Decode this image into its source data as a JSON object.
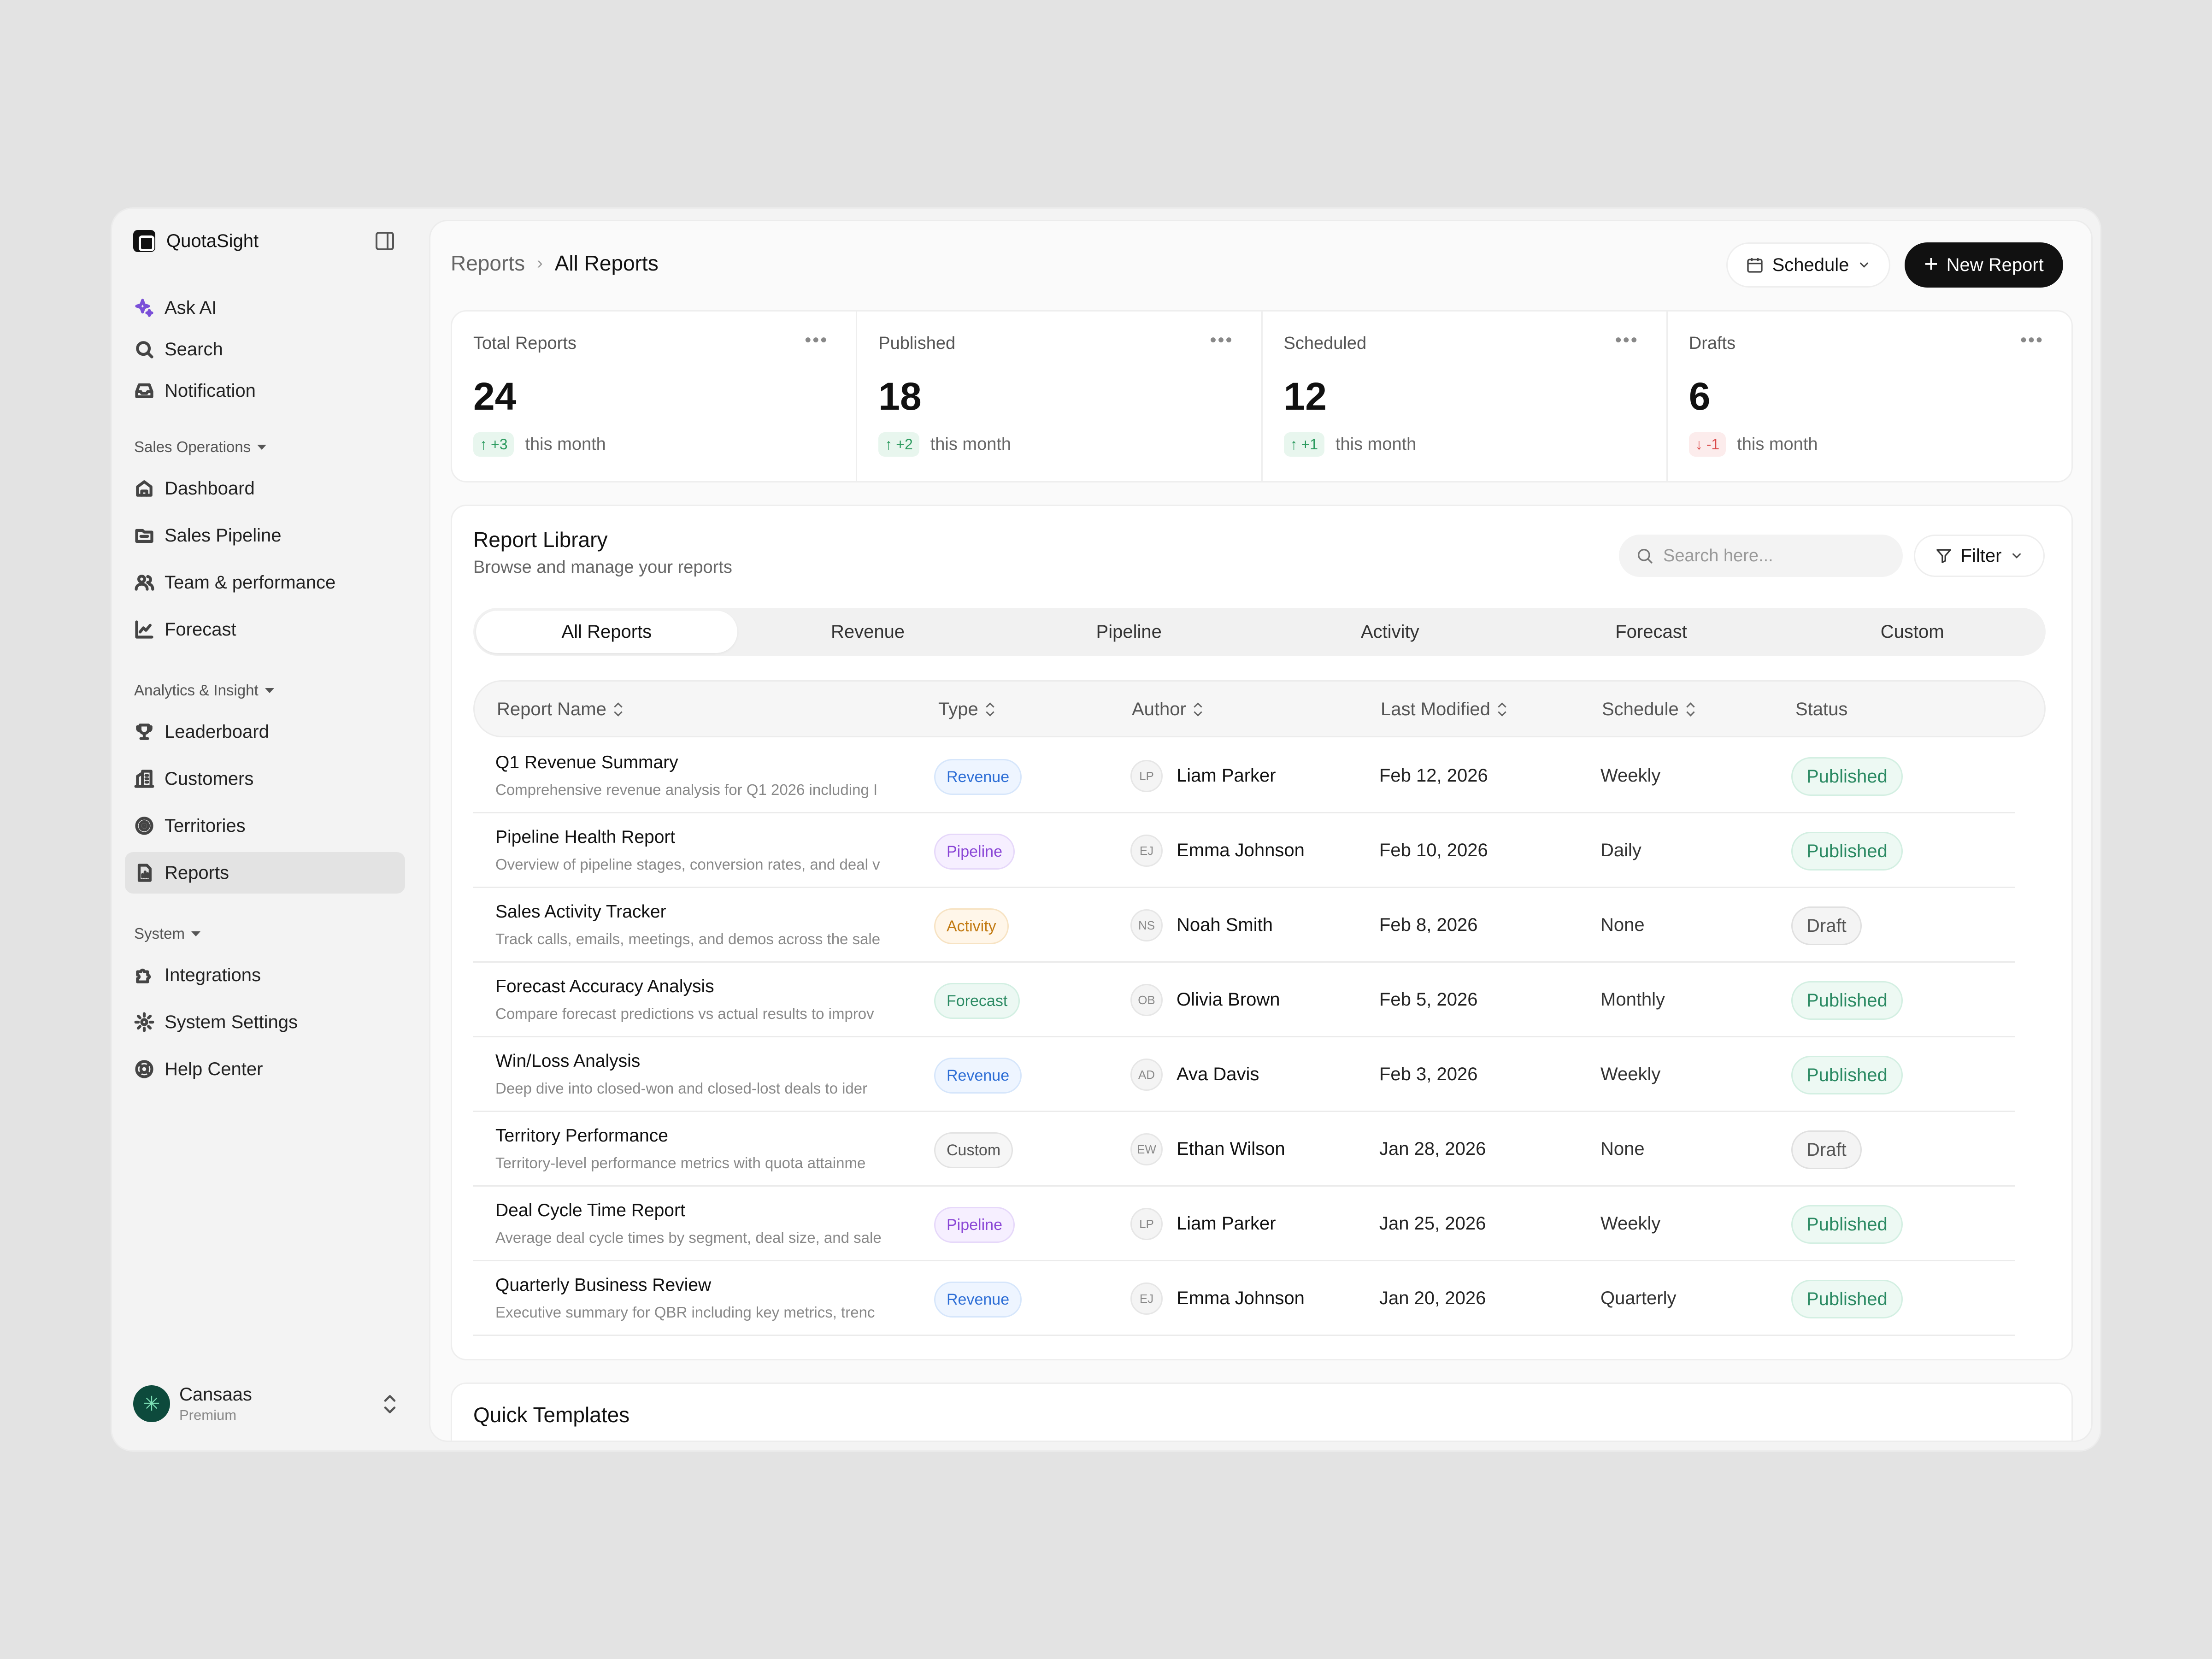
{
  "app": {
    "name": "QuotaSight"
  },
  "sidebar": {
    "top_items": [
      {
        "label": "Ask AI",
        "icon": "sparkle-icon"
      },
      {
        "label": "Search",
        "icon": "search-icon"
      },
      {
        "label": "Notification",
        "icon": "inbox-icon"
      }
    ],
    "sections": [
      {
        "title": "Sales Operations",
        "items": [
          {
            "label": "Dashboard",
            "icon": "home-icon"
          },
          {
            "label": "Sales Pipeline",
            "icon": "folder-icon"
          },
          {
            "label": "Team & performance",
            "icon": "users-icon"
          },
          {
            "label": "Forecast",
            "icon": "chart-line-icon"
          }
        ]
      },
      {
        "title": "Analytics & Insight",
        "items": [
          {
            "label": "Leaderboard",
            "icon": "trophy-icon"
          },
          {
            "label": "Customers",
            "icon": "building-icon"
          },
          {
            "label": "Territories",
            "icon": "target-icon"
          },
          {
            "label": "Reports",
            "icon": "report-icon"
          }
        ]
      },
      {
        "title": "System",
        "items": [
          {
            "label": "Integrations",
            "icon": "puzzle-icon"
          },
          {
            "label": "System Settings",
            "icon": "gear-icon"
          },
          {
            "label": "Help Center",
            "icon": "lifebuoy-icon"
          }
        ]
      }
    ],
    "active_item": "Reports",
    "account": {
      "name": "Cansaas",
      "plan": "Premium"
    }
  },
  "header": {
    "breadcrumb": [
      "Reports",
      "All Reports"
    ],
    "schedule_label": "Schedule",
    "new_report_label": "New Report"
  },
  "stats": [
    {
      "label": "Total Reports",
      "value": "24",
      "delta": "+3",
      "direction": "up",
      "suffix": "this month"
    },
    {
      "label": "Published",
      "value": "18",
      "delta": "+2",
      "direction": "up",
      "suffix": "this month"
    },
    {
      "label": "Scheduled",
      "value": "12",
      "delta": "+1",
      "direction": "up",
      "suffix": "this month"
    },
    {
      "label": "Drafts",
      "value": "6",
      "delta": "-1",
      "direction": "down",
      "suffix": "this month"
    }
  ],
  "library": {
    "title": "Report Library",
    "subtitle": "Browse and manage your reports",
    "search_placeholder": "Search here...",
    "filter_label": "Filter",
    "tabs": [
      "All Reports",
      "Revenue",
      "Pipeline",
      "Activity",
      "Forecast",
      "Custom"
    ],
    "active_tab": "All Reports",
    "columns": [
      "Report Name",
      "Type",
      "Author",
      "Last Modified",
      "Schedule",
      "Status"
    ],
    "rows": [
      {
        "name": "Q1 Revenue Summary",
        "desc": "Comprehensive revenue analysis for Q1 2026 including I",
        "type": "Revenue",
        "initials": "LP",
        "author": "Liam Parker",
        "date": "Feb 12, 2026",
        "schedule": "Weekly",
        "status": "Published"
      },
      {
        "name": "Pipeline Health Report",
        "desc": "Overview of pipeline stages, conversion rates, and deal v",
        "type": "Pipeline",
        "initials": "EJ",
        "author": "Emma Johnson",
        "date": "Feb 10, 2026",
        "schedule": "Daily",
        "status": "Published"
      },
      {
        "name": "Sales Activity Tracker",
        "desc": "Track calls, emails, meetings, and demos across the sale",
        "type": "Activity",
        "initials": "NS",
        "author": "Noah Smith",
        "date": "Feb 8, 2026",
        "schedule": "None",
        "status": "Draft"
      },
      {
        "name": "Forecast Accuracy Analysis",
        "desc": "Compare forecast predictions vs actual results to improv",
        "type": "Forecast",
        "initials": "OB",
        "author": "Olivia Brown",
        "date": "Feb 5, 2026",
        "schedule": "Monthly",
        "status": "Published"
      },
      {
        "name": "Win/Loss Analysis",
        "desc": "Deep dive into closed-won and closed-lost deals to ider",
        "type": "Revenue",
        "initials": "AD",
        "author": "Ava Davis",
        "date": "Feb 3, 2026",
        "schedule": "Weekly",
        "status": "Published"
      },
      {
        "name": "Territory Performance",
        "desc": "Territory-level performance metrics with quota attainme",
        "type": "Custom",
        "initials": "EW",
        "author": "Ethan Wilson",
        "date": "Jan 28, 2026",
        "schedule": "None",
        "status": "Draft"
      },
      {
        "name": "Deal Cycle Time Report",
        "desc": "Average deal cycle times by segment, deal size, and sale",
        "type": "Pipeline",
        "initials": "LP",
        "author": "Liam Parker",
        "date": "Jan 25, 2026",
        "schedule": "Weekly",
        "status": "Published"
      },
      {
        "name": "Quarterly Business Review",
        "desc": "Executive summary for QBR including key metrics, trenc",
        "type": "Revenue",
        "initials": "EJ",
        "author": "Emma Johnson",
        "date": "Jan 20, 2026",
        "schedule": "Quarterly",
        "status": "Published"
      }
    ]
  },
  "quick_templates": {
    "title": "Quick Templates"
  }
}
